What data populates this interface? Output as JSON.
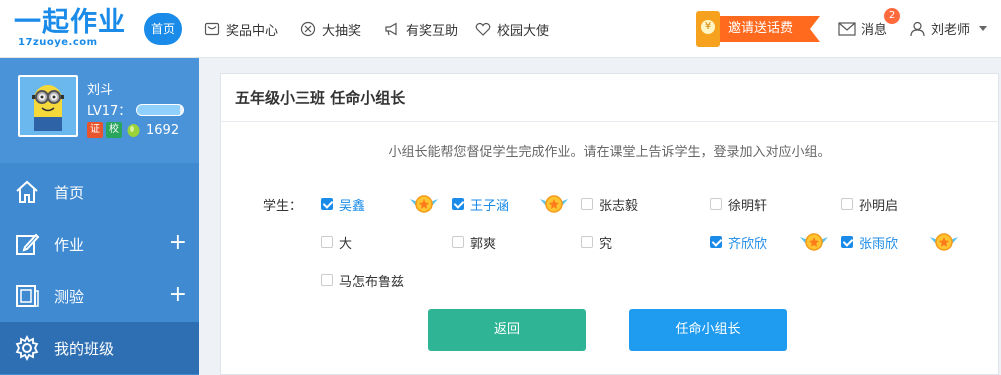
{
  "header": {
    "logo_text": "一起作业",
    "logo_sub": "17zuoye.com",
    "home_badge": "首页",
    "nav": [
      {
        "label": "奖品中心",
        "icon": "gift-icon"
      },
      {
        "label": "大抽奖",
        "icon": "lottery-icon"
      },
      {
        "label": "有奖互助",
        "icon": "megaphone-icon"
      },
      {
        "label": "校园大使",
        "icon": "heart-icon"
      }
    ],
    "invite_label": "邀请送话费",
    "messages_label": "消息",
    "messages_count": "2",
    "user_label": "刘老师"
  },
  "sidebar": {
    "profile": {
      "name": "刘斗",
      "level": "LV17：",
      "level_progress": 0.92,
      "tag_cert": "证",
      "tag_school": "校",
      "points": "1692"
    },
    "menu": [
      {
        "label": "首页",
        "icon": "home-icon",
        "expandable": false
      },
      {
        "label": "作业",
        "icon": "edit-icon",
        "expandable": true
      },
      {
        "label": "测验",
        "icon": "quiz-icon",
        "expandable": true
      },
      {
        "label": "我的班级",
        "icon": "gear-icon",
        "expandable": false
      }
    ],
    "expand_symbol": "+"
  },
  "main": {
    "title": "五年级小三班 任命小组长",
    "hint": "小组长能帮您督促学生完成作业。请在课堂上告诉学生，登录加入对应小组。",
    "students_label": "学生：",
    "students": [
      {
        "name": "吴鑫",
        "checked": true
      },
      {
        "name": "王子涵",
        "checked": true
      },
      {
        "name": "张志毅",
        "checked": false
      },
      {
        "name": "徐明轩",
        "checked": false
      },
      {
        "name": "孙明启",
        "checked": false
      },
      {
        "name": "大",
        "checked": false
      },
      {
        "name": "郭爽",
        "checked": false
      },
      {
        "name": "究",
        "checked": false
      },
      {
        "name": "齐欣欣",
        "checked": true
      },
      {
        "name": "张雨欣",
        "checked": true
      },
      {
        "name": "马怎布鲁兹",
        "checked": false
      }
    ],
    "back_button": "返回",
    "assign_button": "任命小组长"
  },
  "colors": {
    "brand": "#1a8be8",
    "sidebar": "#3f8ad1",
    "sidebar_active": "#2e6fb3",
    "back_button": "#2fb596",
    "assign_button": "#1f9cf0",
    "invite": "#ff6a1f"
  }
}
